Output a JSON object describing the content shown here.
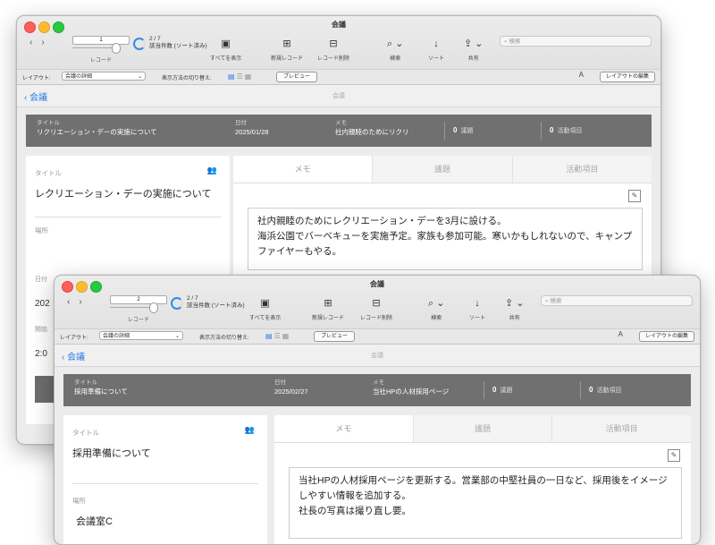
{
  "back": {
    "window_title": "会議",
    "record": {
      "current": "1",
      "count": "2 / 7",
      "count_note": "該当件数 (ソート済み)",
      "label": "レコード"
    },
    "toolbar": {
      "show_all": "すべてを表示",
      "new_record": "新規レコード",
      "delete_record": "レコード削除",
      "find": "検索",
      "sort": "ソート",
      "share": "共有",
      "search_placeholder": "検索"
    },
    "layout_bar": {
      "layout_label": "レイアウト:",
      "layout_value": "会議の詳細",
      "switch_label": "表示方法の切り替え:",
      "preview": "プレビュー",
      "aa": "A",
      "edit_layout": "レイアウトの編集"
    },
    "nav": {
      "back_label": "会議",
      "title": "会議"
    },
    "summary": {
      "title_label": "タイトル",
      "title_value": "リクリエーション・デーの実施について",
      "date_label": "日付",
      "date_value": "2025/01/28",
      "memo_label": "メモ",
      "memo_value": "社内親睦のためにリクリ",
      "topics_count": "0",
      "topics_label": "議題",
      "actions_count": "0",
      "actions_label": "活動項目"
    },
    "left": {
      "title_label": "タイトル",
      "title_value": "レクリエーション・デーの実施について",
      "place_label": "場所",
      "date_label_peek": "日付",
      "date_value_peek": "202",
      "start_label_peek": "開始",
      "start_value_peek": "2:0"
    },
    "tabs": [
      "メモ",
      "議題",
      "活動項目"
    ],
    "memo_lines": [
      "社内親睦のためにレクリエーション・デーを3月に設ける。",
      "海浜公園でバーベキューを実施予定。家族も参加可能。寒いかもしれないので、キャンプファイヤーもやる。"
    ]
  },
  "front": {
    "window_title": "会議",
    "record": {
      "current": "2",
      "count": "2 / 7",
      "count_note": "該当件数 (ソート済み)",
      "label": "レコード"
    },
    "toolbar": {
      "show_all": "すべてを表示",
      "new_record": "新規レコード",
      "delete_record": "レコード削除",
      "find": "検索",
      "sort": "ソート",
      "share": "共有",
      "search_placeholder": "検索"
    },
    "layout_bar": {
      "layout_label": "レイアウト:",
      "layout_value": "会議の詳細",
      "switch_label": "表示方法の切り替え:",
      "preview": "プレビュー",
      "aa": "A",
      "edit_layout": "レイアウトの編集"
    },
    "nav": {
      "back_label": "会議",
      "title": "会議"
    },
    "summary": {
      "title_label": "タイトル",
      "title_value": "採用準備について",
      "date_label": "日付",
      "date_value": "2025/02/27",
      "memo_label": "メモ",
      "memo_value": "当社HPの人材採用ページ",
      "topics_count": "0",
      "topics_label": "議題",
      "actions_count": "0",
      "actions_label": "活動項目"
    },
    "left": {
      "title_label": "タイトル",
      "title_value": "採用準備について",
      "place_label": "場所",
      "place_value": "会議室C"
    },
    "tabs": [
      "メモ",
      "議題",
      "活動項目"
    ],
    "memo_lines": [
      "当社HPの人材採用ページを更新する。営業部の中堅社員の一日など、採用後をイメージしやすい情報を追加する。",
      "社長の写真は撮り直し要。"
    ]
  },
  "colors": {
    "accent": "#2f7be6",
    "summary_bg": "#707070"
  }
}
